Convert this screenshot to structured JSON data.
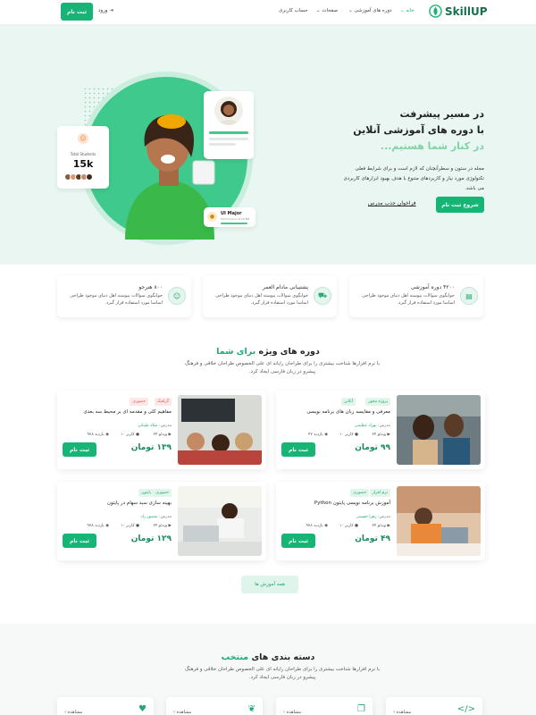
{
  "header": {
    "logo": "SkillUP",
    "nav": [
      "خانه",
      "دوره های آموزشی",
      "صفحات",
      "حساب کاربری"
    ],
    "login": "ورود",
    "register": "ثبت نام"
  },
  "hero": {
    "title1": "در مسیر پیشرفت",
    "title2": "با دوره های آموزشی آنلاین",
    "title3": "در کنار شما هستیم...",
    "desc": "مجله در ستون و سطرآنچنان که لازم است و برای شرایط فعلی تکنولوژی مورد نیاز و کاربردهای متنوع با هدف بهبود ابزارهای کاربردی می باشد.",
    "cta": "شروع ثبت نام",
    "link": "فراخوان جذب مدرس",
    "students_label": "Total Students",
    "students_value": "15k",
    "mentor_name": "UI Major",
    "mentor_time": "Tomorrow is at 10 PM"
  },
  "features": [
    {
      "title": "۴۲۰۰ دوره آموزشی",
      "desc": "جوابگوی سوالات پیوسته اهل دنیای موجود طراحی اساسا مورد استفاده قرار گیرد."
    },
    {
      "title": "پشتیبانی مادام العمر",
      "desc": "جوابگوی سوالات پیوسته اهل دنیای موجود طراحی اساسا مورد استفاده قرار گیرد."
    },
    {
      "title": "۸۰۰ هنرجو",
      "desc": "جوابگوی سوالات پیوسته اهل دنیای موجود طراحی اساسا مورد استفاده قرار گیرد."
    }
  ],
  "special": {
    "title_a": "دوره های ویژه",
    "title_b": "برای شما",
    "desc": "با نرم افزارها شناخت بیشتری را برای طراحان رایانه ای علی الخصوص طراحان خلاقی و فرهنگ پیشرو در زبان فارسی ایجاد کرد.",
    "all_button": "همه آموزش ها"
  },
  "courses": [
    {
      "tags": [
        "آنلاین",
        "پروژه محور"
      ],
      "title": "معرفی و مقایسه زبان های برنامه نویسی",
      "instructor_label": "مدرس:",
      "instructor": "بهزاد عظیمی",
      "videos": "۲۴ ویدئو",
      "users": "۱۰ کاربر",
      "views": "۴۲ بازدید",
      "price": "۹۹ تومان",
      "register": "ثبت نام"
    },
    {
      "tags": [
        "حضوری",
        "گرافیک"
      ],
      "title": "مفاهیم کلی و مقدمه ای بر محیط سه بعدی",
      "instructor_label": "مدرس:",
      "instructor": "میلاد طیباتی",
      "videos": "۲۴ ویدئو",
      "users": "۱۰ کاربر",
      "views": "۹۷۸ بازدید",
      "price": "۱۳۹ تومان",
      "register": "ثبت نام"
    },
    {
      "tags": [
        "حضوری",
        "نرم افزار"
      ],
      "title": "آموزش برنامه نویسی پایتون Python",
      "instructor_label": "مدرس:",
      "instructor": "زهرا حسینی",
      "videos": "۲۴ ویدئو",
      "users": "۱۰ کاربر",
      "views": "۹۷۸ بازدید",
      "price": "۴۹ تومان",
      "register": "ثبت نام"
    },
    {
      "tags": [
        "پایتون",
        "حضوری"
      ],
      "title": "بهینه سازی سبد سهام در پایتون",
      "instructor_label": "مدرس:",
      "instructor": "منصور راد",
      "videos": "۲۴ ویدئو",
      "users": "۱۰ کاربر",
      "views": "۹۷۸ بازدید",
      "price": "۱۲۹ تومان",
      "register": "ثبت نام"
    }
  ],
  "categories": {
    "title_a": "دسته بندی های",
    "title_b": "منتخب",
    "desc": "با نرم افزارها شناخت بیشتری را برای طراحان رایانه ای علی الخصوص طراحان خلاقی و فرهنگ پیشرو در زبان فارسی ایجاد کرد.",
    "items": [
      "مشاهده ›",
      "مشاهده ›",
      "مشاهده ›",
      "مشاهده ›"
    ]
  },
  "colors": {
    "accent": "#16b576",
    "hero_bg": "#eaf6f1"
  }
}
